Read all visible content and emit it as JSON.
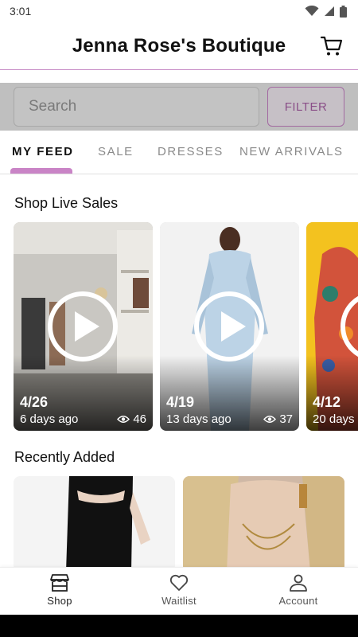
{
  "status_bar": {
    "time": "3:01"
  },
  "header": {
    "title": "Jenna Rose's Boutique",
    "cart_icon": "cart-icon"
  },
  "search": {
    "placeholder": "Search",
    "filter_label": "FILTER"
  },
  "tabs": [
    {
      "label": "MY FEED",
      "active": true
    },
    {
      "label": "SALE",
      "active": false
    },
    {
      "label": "DRESSES",
      "active": false
    },
    {
      "label": "NEW ARRIVALS",
      "active": false
    }
  ],
  "live_sales": {
    "title": "Shop Live Sales",
    "cards": [
      {
        "date": "4/26",
        "ago": "6 days ago",
        "views": "46"
      },
      {
        "date": "4/19",
        "ago": "13 days ago",
        "views": "37"
      },
      {
        "date": "4/12",
        "ago": "20 days"
      }
    ]
  },
  "recently_added": {
    "title": "Recently Added"
  },
  "bottom_nav": [
    {
      "label": "Shop",
      "icon": "store-icon",
      "active": true
    },
    {
      "label": "Waitlist",
      "icon": "heart-icon",
      "active": false
    },
    {
      "label": "Account",
      "icon": "person-icon",
      "active": false
    }
  ],
  "colors": {
    "accent": "#c984c6",
    "accent_dark": "#8a4f88",
    "search_band": "#bfbfbf"
  }
}
